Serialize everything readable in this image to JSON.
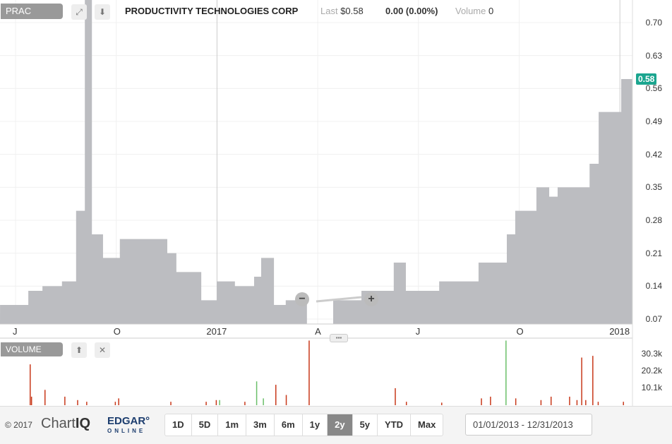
{
  "header": {
    "symbol": "PRAC",
    "company": "PRODUCTIVITY TECHNOLOGIES CORP",
    "last_label": "Last",
    "last_value": "$0.58",
    "change": "0.00 (0.00%)",
    "volume_label": "Volume",
    "volume_value": "0",
    "current_price_tag": "0.58"
  },
  "price_axis": [
    "0.70",
    "0.63",
    "0.56",
    "0.49",
    "0.42",
    "0.35",
    "0.28",
    "0.21",
    "0.14",
    "0.07"
  ],
  "time_axis": [
    "J",
    "O",
    "2017",
    "A",
    "J",
    "O",
    "2018"
  ],
  "volume_panel": {
    "label": "VOLUME",
    "axis": [
      "30.3k",
      "20.2k",
      "10.1k"
    ]
  },
  "colors": {
    "area": "#bcbdc1",
    "up": "#6abf69",
    "down": "#c8381a",
    "accent": "#1ba58f"
  },
  "chart_data": {
    "type": "area",
    "x_unit": "months since Jul 2016",
    "price_steps": [
      [
        -0.46,
        0.1
      ],
      [
        0.38,
        0.13
      ],
      [
        0.8,
        0.14
      ],
      [
        1.38,
        0.15
      ],
      [
        1.8,
        0.3
      ],
      [
        2.06,
        0.8
      ],
      [
        2.27,
        0.25
      ],
      [
        2.6,
        0.2
      ],
      [
        3.1,
        0.24
      ],
      [
        4.51,
        0.21
      ],
      [
        4.78,
        0.17
      ],
      [
        5.52,
        0.11
      ],
      [
        5.98,
        0.15
      ],
      [
        6.52,
        0.14
      ],
      [
        7.09,
        0.16
      ],
      [
        7.3,
        0.2
      ],
      [
        7.68,
        0.1
      ],
      [
        8.03,
        0.11
      ],
      [
        8.66,
        0.06
      ],
      [
        9.44,
        0.11
      ],
      [
        10.28,
        0.13
      ],
      [
        11.24,
        0.19
      ],
      [
        11.6,
        0.13
      ],
      [
        12.59,
        0.15
      ],
      [
        13.76,
        0.19
      ],
      [
        14.6,
        0.25
      ],
      [
        14.85,
        0.3
      ],
      [
        15.48,
        0.35
      ],
      [
        15.86,
        0.33
      ],
      [
        16.11,
        0.35
      ],
      [
        17.06,
        0.4
      ],
      [
        17.33,
        0.51
      ],
      [
        18.0,
        0.58
      ],
      [
        18.34,
        0.58
      ]
    ],
    "volume": [
      [
        0.42,
        24000,
        "down"
      ],
      [
        0.46,
        5000,
        "down"
      ],
      [
        0.86,
        9000,
        "down"
      ],
      [
        1.45,
        5000,
        "down"
      ],
      [
        1.83,
        3000,
        "down"
      ],
      [
        2.1,
        2000,
        "down"
      ],
      [
        2.95,
        2000,
        "down"
      ],
      [
        3.05,
        4000,
        "down"
      ],
      [
        4.6,
        2000,
        "down"
      ],
      [
        5.65,
        2000,
        "down"
      ],
      [
        5.95,
        3000,
        "down"
      ],
      [
        6.05,
        3000,
        "up"
      ],
      [
        6.8,
        2000,
        "down"
      ],
      [
        7.15,
        14000,
        "up"
      ],
      [
        7.35,
        4000,
        "up"
      ],
      [
        7.72,
        12000,
        "down"
      ],
      [
        8.03,
        6000,
        "down"
      ],
      [
        8.71,
        38000,
        "down"
      ],
      [
        11.27,
        10000,
        "down"
      ],
      [
        11.6,
        2000,
        "down"
      ],
      [
        12.65,
        1500,
        "down"
      ],
      [
        13.83,
        4000,
        "down"
      ],
      [
        14.1,
        5000,
        "down"
      ],
      [
        14.56,
        38000,
        "up"
      ],
      [
        14.85,
        4000,
        "down"
      ],
      [
        15.6,
        3000,
        "down"
      ],
      [
        15.9,
        5000,
        "down"
      ],
      [
        16.45,
        5000,
        "down"
      ],
      [
        16.67,
        3000,
        "down"
      ],
      [
        16.81,
        28000,
        "down"
      ],
      [
        16.93,
        3000,
        "down"
      ],
      [
        17.14,
        29000,
        "down"
      ],
      [
        17.3,
        2000,
        "down"
      ],
      [
        18.05,
        2000,
        "down"
      ]
    ],
    "ylim": [
      0.07,
      0.7
    ],
    "volume_max": 30300
  },
  "footer": {
    "copyright": "© 2017",
    "brand1": "Chart",
    "brand1b": "IQ",
    "brand2": "EDGAR°",
    "brand2b": "ONLINE",
    "ranges": [
      "1D",
      "5D",
      "1m",
      "3m",
      "6m",
      "1y",
      "2y",
      "5y",
      "YTD",
      "Max"
    ],
    "active_range": "2y",
    "date_range": "01/01/2013 - 12/31/2013"
  }
}
